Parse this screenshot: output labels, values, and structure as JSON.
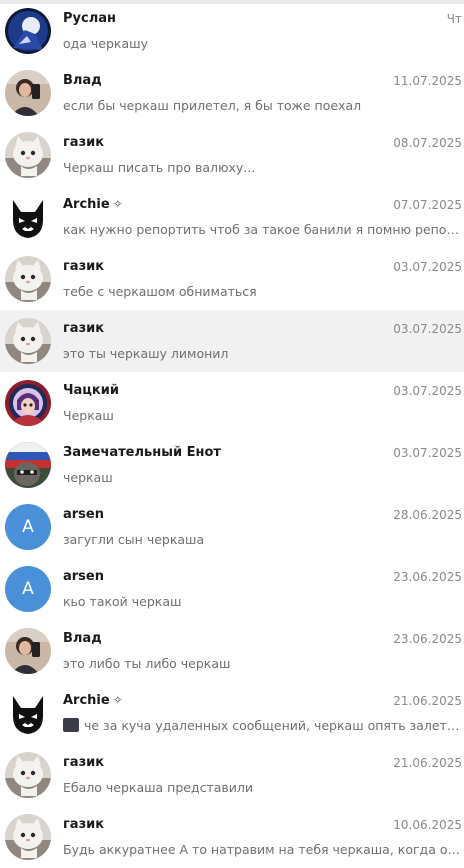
{
  "chats": [
    {
      "name": "Руслан",
      "date": "Чт",
      "preview": "ода черкашу",
      "avatar": "avatar-ruslan"
    },
    {
      "name": "Влад",
      "date": "11.07.2025",
      "preview": "если бы черкаш прилетел, я бы тоже поехал",
      "avatar": "avatar-vlad"
    },
    {
      "name": "газик",
      "date": "08.07.2025",
      "preview": "Черкаш писать про валюху...",
      "avatar": "avatar-gazik"
    },
    {
      "name": "Archie",
      "badge": "✧",
      "date": "07.07.2025",
      "preview": "как нужно репортить чтоб за такое банили я помню репортил",
      "avatar": "avatar-archie"
    },
    {
      "name": "газик",
      "date": "03.07.2025",
      "preview": "тебе с черкашом обниматься",
      "avatar": "avatar-gazik"
    },
    {
      "name": "газик",
      "date": "03.07.2025",
      "preview": "это ты черкашу лимонил",
      "avatar": "avatar-gazik",
      "selected": true
    },
    {
      "name": "Чацкий",
      "date": "03.07.2025",
      "preview": "Черкаш",
      "avatar": "avatar-chatsky"
    },
    {
      "name": "Замечательный Енот",
      "date": "03.07.2025",
      "preview": "черкаш",
      "avatar": "avatar-enot"
    },
    {
      "name": "arsen",
      "date": "28.06.2025",
      "preview": "загугли сын черкаша",
      "avatar": "avatar-letter",
      "letter": "A"
    },
    {
      "name": "arsen",
      "date": "23.06.2025",
      "preview": "кьо такой черкаш",
      "avatar": "avatar-letter",
      "letter": "A"
    },
    {
      "name": "Влад",
      "date": "23.06.2025",
      "preview": "это либо ты либо черкаш",
      "avatar": "avatar-vlad"
    },
    {
      "name": "Archie",
      "badge": "✧",
      "date": "21.06.2025",
      "preview": "че за куча удаленных сообщений, черкаш опять залетал ?",
      "avatar": "avatar-archie",
      "thumb": true
    },
    {
      "name": "газик",
      "date": "21.06.2025",
      "preview": "Ебало черкаша представили",
      "avatar": "avatar-gazik"
    },
    {
      "name": "газик",
      "date": "10.06.2025",
      "preview": "Будь аккуратнее А то натравим на тебя черкаша, когда он в ПВ",
      "avatar": "avatar-gazik"
    }
  ],
  "colors": {
    "selected_bg": "#f1f1f1",
    "letter_avatar": "#4a90d9",
    "date": "#8a8a8a",
    "preview": "#6f6f6f"
  }
}
